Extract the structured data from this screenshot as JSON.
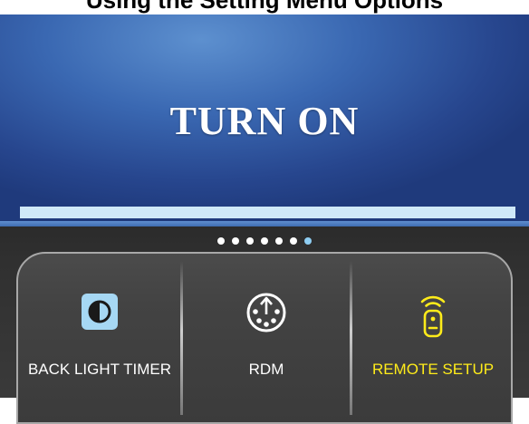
{
  "header": {
    "partial_title": "Using the Setting Menu Options"
  },
  "screen": {
    "title": "TURN ON",
    "progress_fraction": 0.999
  },
  "pagination": {
    "total_dots": 7,
    "active_index": 6
  },
  "menu": {
    "tiles": [
      {
        "label": "BACK LIGHT TIMER",
        "icon": "contrast-icon",
        "selected": false
      },
      {
        "label": "RDM",
        "icon": "dmx-connector-icon",
        "selected": false
      },
      {
        "label": "REMOTE SETUP",
        "icon": "remote-control-icon",
        "selected": true
      }
    ]
  },
  "colors": {
    "screen_blue": "#3a68b2",
    "progress_fill": "#cfe9f8",
    "active_dot": "#8ecdf2",
    "selected_label": "#ffec1a",
    "label_default": "#ffffff"
  }
}
